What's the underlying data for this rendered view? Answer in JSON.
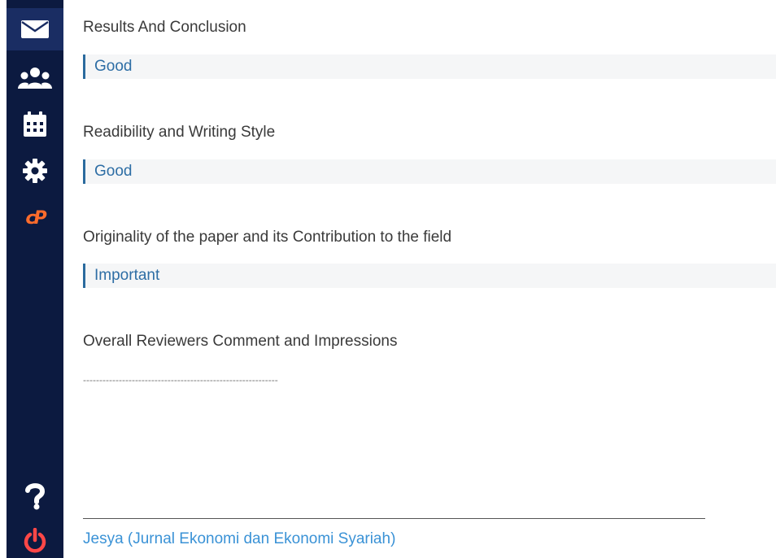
{
  "sidebar": {
    "items": [
      {
        "icon": "envelope-icon",
        "active": true
      },
      {
        "icon": "users-icon"
      },
      {
        "icon": "calendar-icon"
      },
      {
        "icon": "gear-icon"
      },
      {
        "icon": "cpanel-icon",
        "text": "cP"
      },
      {
        "icon": "question-icon"
      },
      {
        "icon": "power-icon"
      }
    ],
    "colors": {
      "background": "#0c1a40",
      "active": "#1a2d63",
      "icon": "#ffffff",
      "cpanel": "#ff6c2c",
      "power": "#ff4747"
    }
  },
  "review": {
    "sections": [
      {
        "label": "Results And Conclusion",
        "answer": "Good"
      },
      {
        "label": "Readibility and Writing Style",
        "answer": "Good"
      },
      {
        "label": "Originality of the paper and its Contribution to the field",
        "answer": "Important"
      },
      {
        "label": "Overall Reviewers Comment and Impressions"
      }
    ],
    "comment_dashes": "------------------------------------------------------------",
    "journal_link": "Jesya (Jurnal Ekonomi dan Ekonomi Syariah)"
  }
}
